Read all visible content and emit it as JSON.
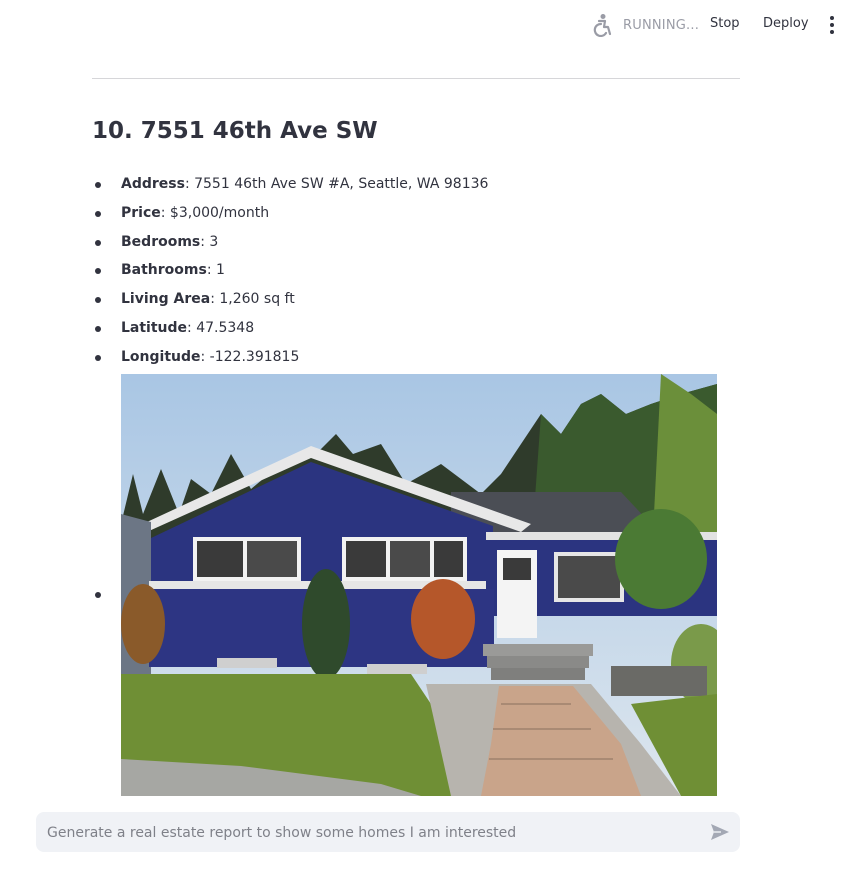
{
  "header": {
    "status_text": "RUNNING...",
    "stop_label": "Stop",
    "deploy_label": "Deploy",
    "status_icon": "running-person-icon",
    "menu_icon": "kebab-menu-icon"
  },
  "listing": {
    "title": "10. 7551 46th Ave SW",
    "details": [
      {
        "label": "Address",
        "value": ": 7551 46th Ave SW #A, Seattle, WA 98136"
      },
      {
        "label": "Price",
        "value": ": $3,000/month"
      },
      {
        "label": "Bedrooms",
        "value": ": 3"
      },
      {
        "label": "Bathrooms",
        "value": ": 1"
      },
      {
        "label": "Living Area",
        "value": ": 1,260 sq ft"
      },
      {
        "label": "Latitude",
        "value": ": 47.5348"
      },
      {
        "label": "Longitude",
        "value": ": -122.391815"
      }
    ],
    "photo": "house-photo"
  },
  "chat": {
    "placeholder": "Generate a real estate report to show some homes I am interested",
    "send_icon": "send-icon"
  },
  "colors": {
    "text": "#31333f",
    "muted": "#9a9ca6",
    "input_bg": "#f0f2f6",
    "house_blue": "#2b3480"
  }
}
